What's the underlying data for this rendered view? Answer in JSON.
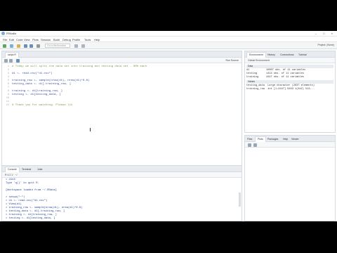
{
  "window": {
    "title": "RStudio",
    "controls": "– □ ×"
  },
  "menu": [
    "File",
    "Edit",
    "Code",
    "View",
    "Plots",
    "Session",
    "Build",
    "Debug",
    "Profile",
    "Tools",
    "Help"
  ],
  "toolbar": {
    "goto_placeholder": "Go to file/function",
    "project": "Project: (None)"
  },
  "editor": {
    "tab": "script.R",
    "tool_right": "Run  Source",
    "lines": [
      {
        "n": "1",
        "text": "# Today we will split the data set into training and testing data set - 80% each",
        "cls": "cmt"
      },
      {
        "n": "2",
        "text": "",
        "cls": ""
      },
      {
        "n": "3",
        "text": "d1 <- read.csv(\"d1.csv\")",
        "cls": "txt"
      },
      {
        "n": "4",
        "text": "",
        "cls": ""
      },
      {
        "n": "5",
        "text": "training_row <- sample(nrow(d1), nrow(d1)*0.8)",
        "cls": "txt"
      },
      {
        "n": "6",
        "text": "testing_data <- d1[-training_row, ]",
        "cls": "txt"
      },
      {
        "n": "7",
        "text": "",
        "cls": ""
      },
      {
        "n": "8",
        "text": "training <- d1[training_row, ]",
        "cls": "txt"
      },
      {
        "n": "9",
        "text": "testing <- d1[testing_data, ]",
        "cls": "txt"
      },
      {
        "n": "10",
        "text": "",
        "cls": ""
      },
      {
        "n": "11",
        "text": "",
        "cls": ""
      },
      {
        "n": "12",
        "text": "# Thank you for watching. Please lik",
        "cls": "cmt"
      }
    ],
    "status_left": "1:1",
    "status_mid": "(Top Level)",
    "status_right": "R Script"
  },
  "console": {
    "tabs": [
      "Console",
      "Terminal",
      "Jobs"
    ],
    "path": "R 4.2.1 · ~/",
    "lines": [
      "> d1v3",
      "Type 'q()' to quit R.",
      "",
      "[Workspace loaded from ~/.RData]",
      "",
      "> setwd(\"~\")",
      "> d1 <- read.csv(\"d1.csv\")",
      "> View(d1)",
      "> training_row <- sample(nrow(d1), nrow(d1)*0.8)",
      "> testing_data <- d1[-training_row, ]",
      "> training <- d1[training_row, ]",
      "> testing <- d1[testing_data, ]",
      ">"
    ]
  },
  "environment": {
    "tabs": [
      "Environment",
      "History",
      "Connections",
      "Tutorial"
    ],
    "scope": "Global Environment",
    "section_data": "Data",
    "rows": [
      "d1           10007 obs. of 11 variables",
      "testing      1414 obs. of 11 variables",
      "training     4447 obs. of 11 variables"
    ],
    "section_values": "Values",
    "values": [
      "testing_data  Large character (2637 elements)",
      "training_row  int [1:4447] 9163 1(842) 513..."
    ]
  },
  "files": {
    "tabs": [
      "Files",
      "Plots",
      "Packages",
      "Help",
      "Viewer"
    ]
  }
}
